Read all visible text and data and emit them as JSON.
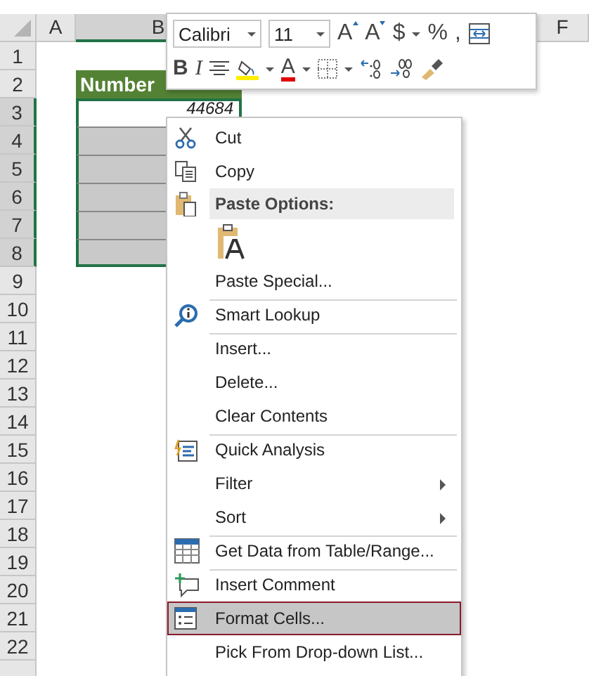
{
  "sheet": {
    "columns": [
      {
        "label": "A",
        "selected": false
      },
      {
        "label": "B",
        "selected": true
      },
      {
        "label": "F",
        "selected": false
      }
    ],
    "rows": [
      "1",
      "2",
      "3",
      "4",
      "5",
      "6",
      "7",
      "8",
      "9",
      "10",
      "11",
      "12",
      "13",
      "14",
      "15",
      "16",
      "17",
      "18",
      "19",
      "20",
      "21",
      "22"
    ],
    "table": {
      "header": "Number",
      "cells": [
        "44684",
        "",
        "",
        "",
        "",
        ""
      ]
    }
  },
  "mini_toolbar": {
    "font": "Calibri",
    "size": "11",
    "row_1": [
      {
        "kind": "grow",
        "label": "A"
      },
      {
        "kind": "shrink",
        "label": "A"
      },
      {
        "kind": "text",
        "label": "$"
      },
      {
        "kind": "caret"
      },
      {
        "kind": "text",
        "label": "%"
      },
      {
        "kind": "text",
        "label": ","
      },
      {
        "kind": "wrap"
      }
    ],
    "row_2": [
      {
        "kind": "bold",
        "label": "B"
      },
      {
        "kind": "italic",
        "label": "I"
      },
      {
        "kind": "align"
      },
      {
        "kind": "fill"
      },
      {
        "kind": "caret"
      },
      {
        "kind": "color",
        "label": "A"
      },
      {
        "kind": "caret"
      },
      {
        "kind": "borders"
      },
      {
        "kind": "caret"
      },
      {
        "kind": "inc-decimal"
      },
      {
        "kind": "dec-decimal"
      },
      {
        "kind": "painter"
      }
    ]
  },
  "context_menu": [
    {
      "kind": "item",
      "label": "Cut",
      "selected": false,
      "separator": false
    },
    {
      "kind": "item",
      "label": "Copy",
      "selected": false,
      "separator": false
    },
    {
      "kind": "header",
      "label": "Paste Options:",
      "selected": false,
      "separator": false
    },
    {
      "kind": "paste-option",
      "selected": false,
      "separator": false
    },
    {
      "kind": "item",
      "label": "Paste Special...",
      "selected": false,
      "separator": false
    },
    {
      "kind": "item",
      "label": "Smart Lookup",
      "selected": false,
      "separator": true
    },
    {
      "kind": "item",
      "label": "Insert...",
      "selected": false,
      "separator": true
    },
    {
      "kind": "item",
      "label": "Delete...",
      "selected": false,
      "separator": false
    },
    {
      "kind": "item",
      "label": "Clear Contents",
      "selected": false,
      "separator": false
    },
    {
      "kind": "item",
      "label": "Quick Analysis",
      "selected": false,
      "separator": true
    },
    {
      "kind": "submenu",
      "label": "Filter",
      "selected": false,
      "separator": false
    },
    {
      "kind": "submenu",
      "label": "Sort",
      "selected": false,
      "separator": false
    },
    {
      "kind": "item",
      "label": "Get Data from Table/Range...",
      "selected": false,
      "separator": true
    },
    {
      "kind": "item",
      "label": "Insert Comment",
      "selected": false,
      "separator": true
    },
    {
      "kind": "item",
      "label": "Format Cells...",
      "selected": true,
      "separator": false
    },
    {
      "kind": "item",
      "label": "Pick From Drop-down List...",
      "selected": false,
      "separator": false
    }
  ]
}
